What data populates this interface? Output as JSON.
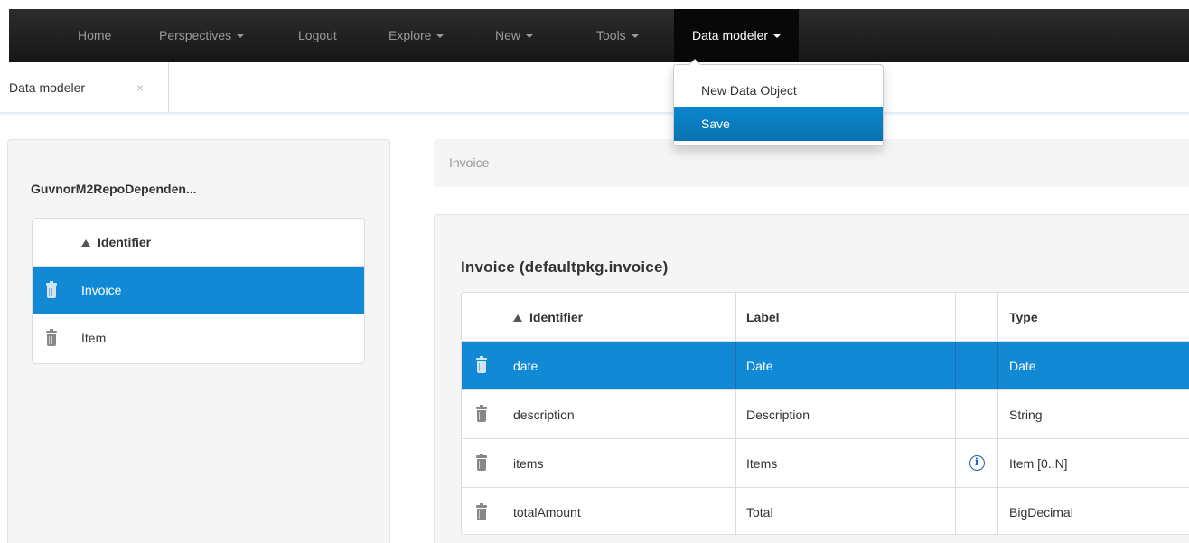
{
  "navbar": {
    "items": [
      {
        "label": "Home",
        "has_caret": false
      },
      {
        "label": "Perspectives",
        "has_caret": true
      },
      {
        "label": "Logout",
        "has_caret": false
      },
      {
        "label": "Explore",
        "has_caret": true
      },
      {
        "label": "New",
        "has_caret": true
      },
      {
        "label": "Tools",
        "has_caret": true
      },
      {
        "label": "Data modeler",
        "has_caret": true,
        "active": true
      }
    ]
  },
  "tabs": [
    {
      "label": "Data modeler",
      "close_icon": "×"
    }
  ],
  "dropdown": {
    "items": [
      {
        "label": "New Data Object",
        "selected": false
      },
      {
        "label": "Save",
        "selected": true
      }
    ]
  },
  "left_panel": {
    "project_name": "GuvnorM2RepoDependen...",
    "table": {
      "header": "Identifier",
      "rows": [
        {
          "identifier": "Invoice",
          "selected": true
        },
        {
          "identifier": "Item",
          "selected": false
        }
      ]
    }
  },
  "breadcrumb": "Invoice",
  "main_panel": {
    "title": "Invoice (defaultpkg.invoice)",
    "table": {
      "headers": {
        "identifier": "Identifier",
        "label": "Label",
        "type": "Type"
      },
      "rows": [
        {
          "identifier": "date",
          "label": "Date",
          "info": false,
          "type": "Date",
          "selected": true
        },
        {
          "identifier": "description",
          "label": "Description",
          "info": false,
          "type": "String",
          "selected": false
        },
        {
          "identifier": "items",
          "label": "Items",
          "info": true,
          "type": "Item [0..N]",
          "selected": false
        },
        {
          "identifier": "totalAmount",
          "label": "Total",
          "info": false,
          "type": "BigDecimal",
          "selected": false
        }
      ]
    }
  },
  "colors": {
    "navbar_bg": "#1a1a1a",
    "selection_blue": "#1189d4",
    "panel_bg": "#f5f5f5"
  },
  "icons": {
    "row_delete": "trash-icon",
    "sort": "sort-asc-icon",
    "info": "info-icon"
  }
}
